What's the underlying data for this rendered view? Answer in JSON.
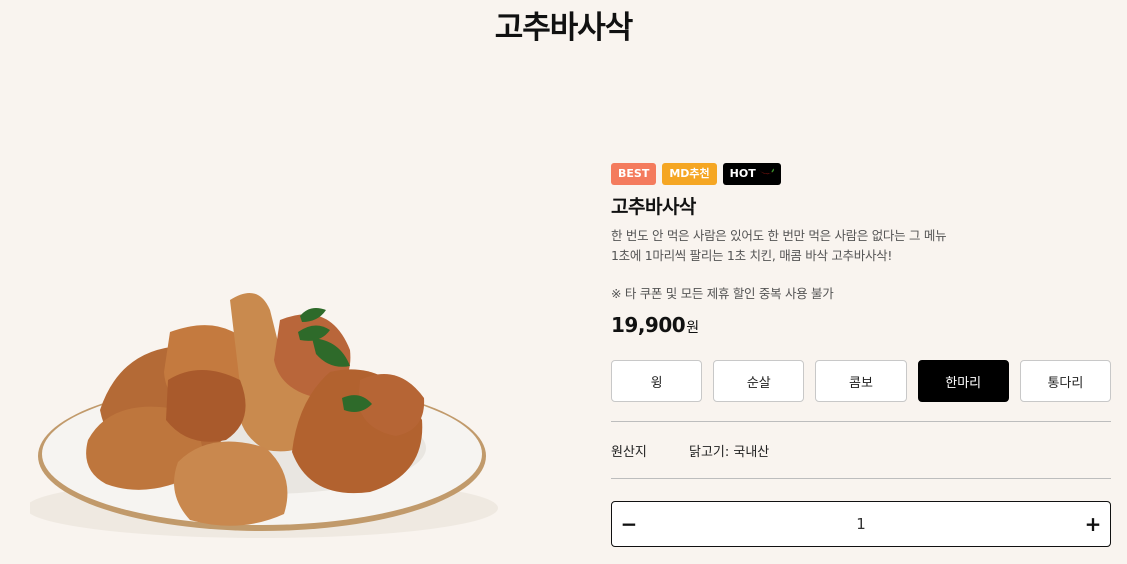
{
  "page": {
    "title": "고추바사삭"
  },
  "product": {
    "image_alt": "고추바사삭",
    "badges": [
      {
        "label": "BEST",
        "color": "#f47b5d"
      },
      {
        "label": "MD추천",
        "color": "#f5a623"
      },
      {
        "label": "HOT",
        "color": "#000000",
        "icon": "chili-pepper-icon"
      }
    ],
    "name": "고추바사삭",
    "description_line1": "한 번도 안 먹은 사람은 있어도 한 번만 먹은 사람은 없다는 그 메뉴",
    "description_line2": "1초에 1마리씩 팔리는 1초 치킨, 매콤 바삭 고추바사삭!",
    "notice": "※ 타 쿠폰 및 모든 제휴 할인 중복 사용 불가",
    "price": "19,900",
    "currency": "원",
    "options": [
      {
        "label": "윙",
        "selected": false
      },
      {
        "label": "순살",
        "selected": false
      },
      {
        "label": "콤보",
        "selected": false
      },
      {
        "label": "한마리",
        "selected": true
      },
      {
        "label": "통다리",
        "selected": false
      }
    ],
    "origin": {
      "label": "원산지",
      "value": "닭고기: 국내산"
    },
    "quantity": {
      "decrement_label": "−",
      "value": "1",
      "increment_label": "+"
    }
  }
}
